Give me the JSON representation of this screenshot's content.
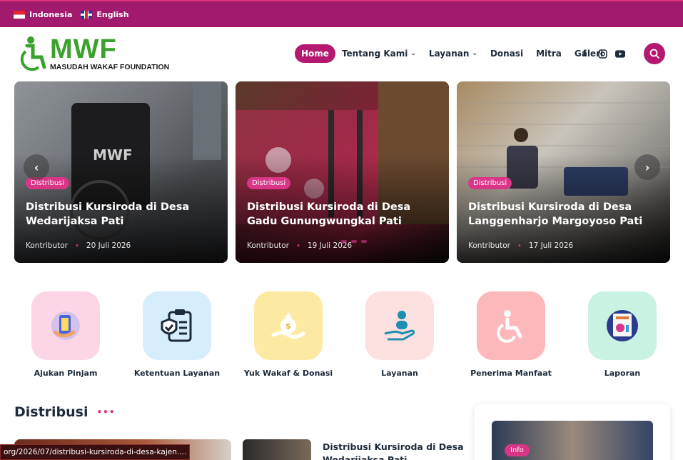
{
  "topbar": {
    "languages": [
      {
        "label": "Indonesia",
        "flag": "indonesia-flag-icon"
      },
      {
        "label": "English",
        "flag": "uk-flag-icon"
      }
    ]
  },
  "header": {
    "logo": {
      "title": "MWF",
      "subtitle": "MASUDAH WAKAF FOUNDATION",
      "color": "#3aa12c"
    },
    "nav": [
      {
        "label": "Home",
        "active": true
      },
      {
        "label": "Tentang Kami",
        "dropdown": true
      },
      {
        "label": "Layanan",
        "dropdown": true
      },
      {
        "label": "Donasi"
      },
      {
        "label": "Mitra"
      },
      {
        "label": "Galeri"
      }
    ],
    "social": [
      "facebook-icon",
      "instagram-icon",
      "youtube-icon"
    ],
    "accent": "#b5196f"
  },
  "slider": {
    "cards": [
      {
        "category": "Distribusi",
        "title": "Distribusi Kursiroda di Desa Wedarijaksa Pati",
        "author": "Kontributor",
        "date": "20 Juli 2026"
      },
      {
        "category": "Distribusi",
        "title": "Distribusi Kursiroda di Desa Gadu Gunungwungkal Pati",
        "author": "Kontributor",
        "date": "19 Juli 2026"
      },
      {
        "category": "Distribusi",
        "title": "Distribusi Kursiroda di Desa Langgenharjo Margoyoso Pati",
        "author": "Kontributor",
        "date": "17 Juli 2026"
      }
    ]
  },
  "quick_links": [
    {
      "label": "Ajukan Pinjam",
      "icon": "clipboard-hand-icon",
      "bg": "#fcd5e6"
    },
    {
      "label": "Ketentuan Layanan",
      "icon": "shield-checklist-icon",
      "bg": "#d6eefb"
    },
    {
      "label": "Yuk Wakaf & Donasi",
      "icon": "money-bag-hand-icon",
      "bg": "#fdeaa2"
    },
    {
      "label": "Layanan",
      "icon": "person-hand-icon",
      "bg": "#fde0e0"
    },
    {
      "label": "Penerima Manfaat",
      "icon": "wheelchair-icon",
      "bg": "#fdb8bb"
    },
    {
      "label": "Laporan",
      "icon": "report-chart-icon",
      "bg": "#c9f2e2"
    }
  ],
  "distribusi": {
    "title": "Distribusi",
    "post_title": "Distribusi Kursiroda di Desa Wedarijaksa Pati"
  },
  "sidebar": {
    "badge": "Info"
  },
  "status_url": "org/2026/07/distribusi-kursiroda-di-desa-kajen...."
}
